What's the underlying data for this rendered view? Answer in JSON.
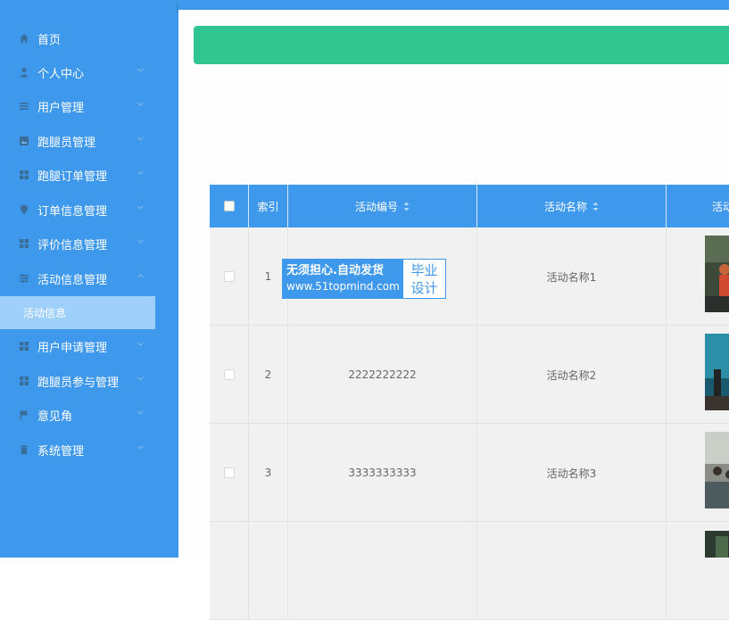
{
  "sidebar": {
    "items": [
      {
        "label": "首页",
        "icon": "home-icon"
      },
      {
        "label": "个人中心",
        "icon": "user-icon"
      },
      {
        "label": "用户管理",
        "icon": "list-icon"
      },
      {
        "label": "跑腿员管理",
        "icon": "image-icon"
      },
      {
        "label": "跑腿订单管理",
        "icon": "grid-icon"
      },
      {
        "label": "订单信息管理",
        "icon": "location-icon"
      },
      {
        "label": "评价信息管理",
        "icon": "grid-icon"
      },
      {
        "label": "活动信息管理",
        "icon": "sliders-icon"
      },
      {
        "label": "用户申请管理",
        "icon": "grid-icon"
      },
      {
        "label": "跑腿员参与管理",
        "icon": "grid-icon"
      },
      {
        "label": "意见角",
        "icon": "flag-icon"
      },
      {
        "label": "系统管理",
        "icon": "trash-icon"
      }
    ],
    "active_sub": "活动信息"
  },
  "table": {
    "headers": {
      "index": "索引",
      "code": "活动编号",
      "name": "活动名称",
      "extra": "活动"
    },
    "rows": [
      {
        "index": "1",
        "code": "",
        "name": "活动名称1"
      },
      {
        "index": "2",
        "code": "2222222222",
        "name": "活动名称2"
      },
      {
        "index": "3",
        "code": "3333333333",
        "name": "活动名称3"
      },
      {
        "index": "",
        "code": "",
        "name": ""
      }
    ]
  },
  "watermark": {
    "line1": "无须担心.自动发货",
    "line2": "www.51topmind.com",
    "badge_top": "毕业",
    "badge_bottom": "设计"
  },
  "colors": {
    "primary": "#3e98eb",
    "banner": "#31c592",
    "submenu": "#9fd0fb"
  }
}
